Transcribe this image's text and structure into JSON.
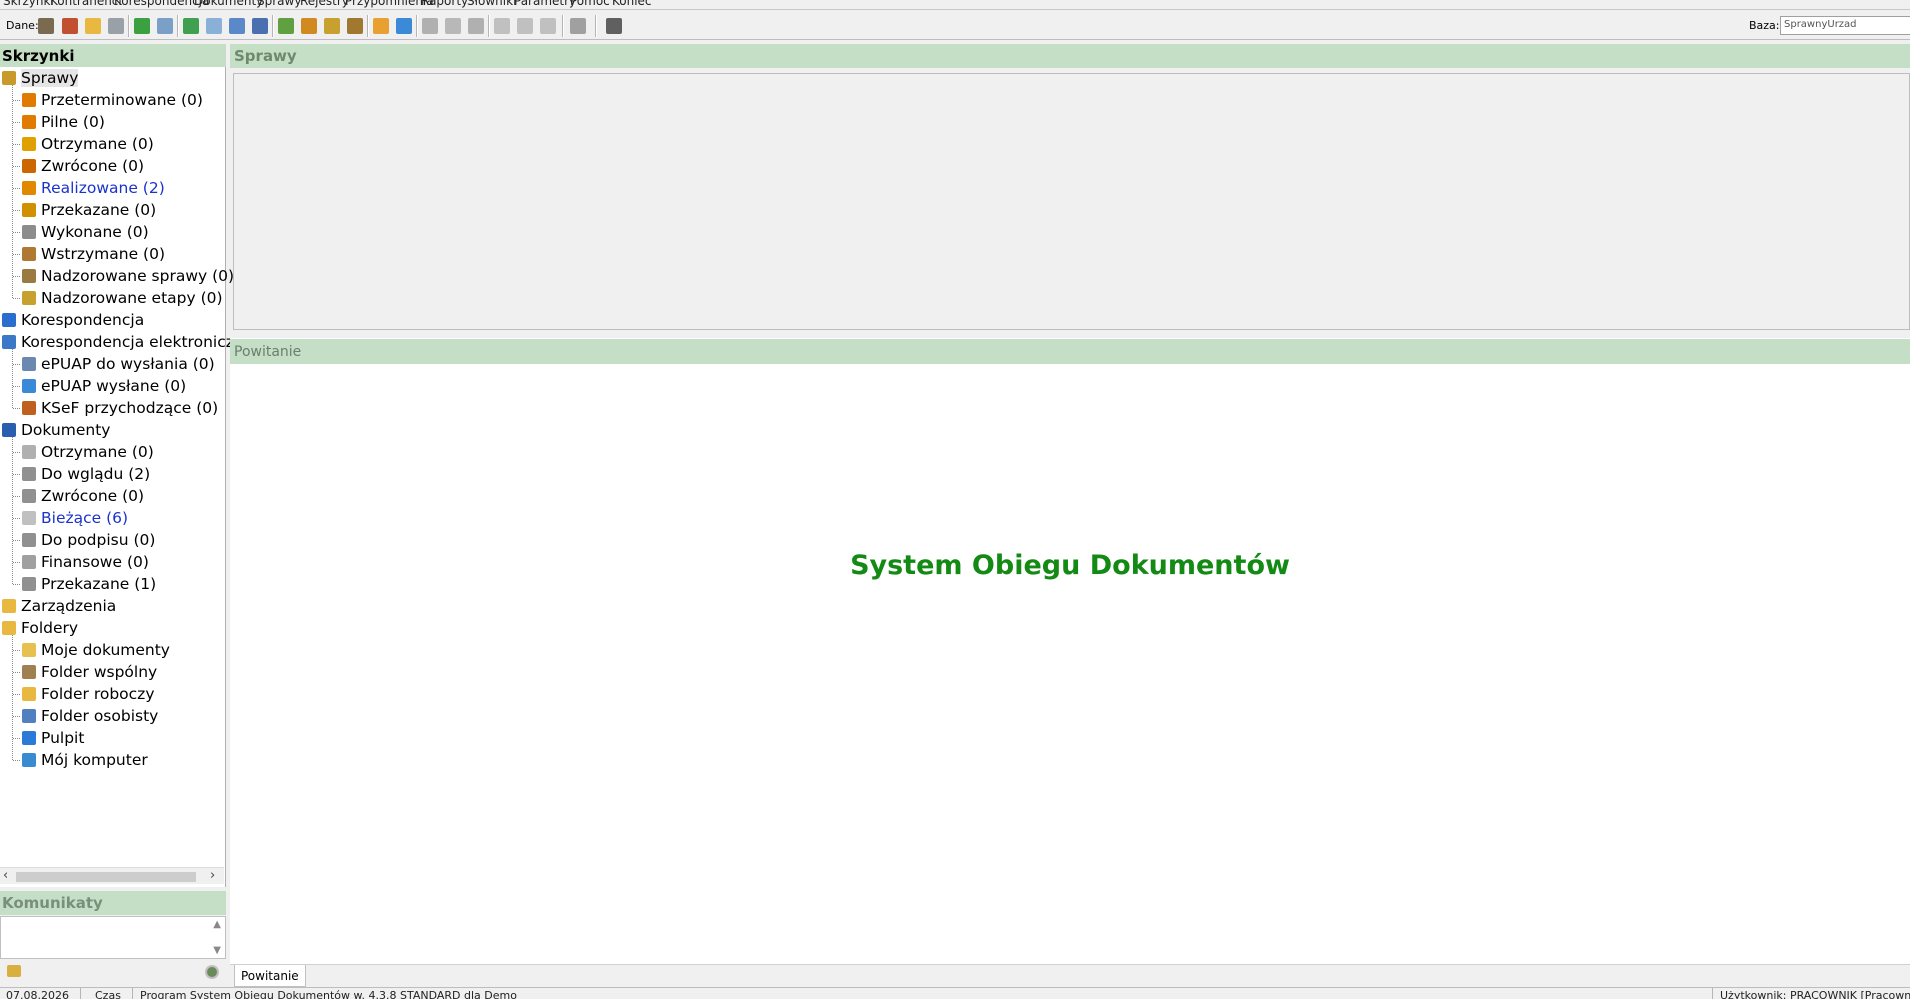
{
  "menu": [
    "Skrzynki",
    "Kontrahenci",
    "Korespondencja",
    "Dokumenty",
    "Sprawy",
    "Rejestry",
    "Przypomnienia",
    "Raporty",
    "Słowniki",
    "Parametry",
    "Pomoc",
    "Koniec"
  ],
  "toolbar": {
    "dane_label": "Dane:",
    "baza_label": "Baza:",
    "baza_value": "SprawnyUrzad"
  },
  "left": {
    "header": "Skrzynki",
    "tree": [
      {
        "label": "Sprawy",
        "level": 0,
        "icon": "case-folder-icon",
        "color": "#c89a2a"
      },
      {
        "label": "Przeterminowane (0)",
        "level": 1,
        "icon": "overdue-icon",
        "color": "#e07a00"
      },
      {
        "label": "Pilne (0)",
        "level": 1,
        "icon": "urgent-icon",
        "color": "#e07a00"
      },
      {
        "label": "Otrzymane (0)",
        "level": 1,
        "icon": "received-icon",
        "color": "#e0a000"
      },
      {
        "label": "Zwrócone (0)",
        "level": 1,
        "icon": "returned-icon",
        "color": "#cc6600"
      },
      {
        "label": "Realizowane (2)",
        "level": 1,
        "icon": "in-progress-icon",
        "color": "#e08800",
        "blue": true
      },
      {
        "label": "Przekazane (0)",
        "level": 1,
        "icon": "forwarded-icon",
        "color": "#d09000"
      },
      {
        "label": "Wykonane (0)",
        "level": 1,
        "icon": "done-icon",
        "color": "#8c8c8c"
      },
      {
        "label": "Wstrzymane (0)",
        "level": 1,
        "icon": "paused-icon",
        "color": "#b07830"
      },
      {
        "label": "Nadzorowane sprawy (0)",
        "level": 1,
        "icon": "supervised-cases-icon",
        "color": "#9a7a40"
      },
      {
        "label": "Nadzorowane etapy (0)",
        "level": 1,
        "icon": "supervised-stages-icon",
        "color": "#c8a030"
      },
      {
        "label": "Korespondencja",
        "level": 0,
        "icon": "correspondence-icon",
        "color": "#2a6fd0"
      },
      {
        "label": "Korespondencja elektroniczn",
        "level": 0,
        "icon": "e-correspondence-icon",
        "color": "#3c78c8"
      },
      {
        "label": "ePUAP do wysłania (0)",
        "level": 1,
        "icon": "epuap-outbox-icon",
        "color": "#6a88b0"
      },
      {
        "label": "ePUAP wysłane (0)",
        "level": 1,
        "icon": "epuap-sent-icon",
        "color": "#3a8ad8"
      },
      {
        "label": "KSeF przychodzące (0)",
        "level": 1,
        "icon": "ksef-icon",
        "color": "#c06020"
      },
      {
        "label": "Dokumenty",
        "level": 0,
        "icon": "documents-icon",
        "color": "#2a5fb0"
      },
      {
        "label": "Otrzymane (0)",
        "level": 1,
        "icon": "doc-received-icon",
        "color": "#b0b0b0"
      },
      {
        "label": "Do wglądu (2)",
        "level": 1,
        "icon": "doc-preview-icon",
        "color": "#909090"
      },
      {
        "label": "Zwrócone (0)",
        "level": 1,
        "icon": "doc-returned-icon",
        "color": "#909090"
      },
      {
        "label": "Bieżące (6)",
        "level": 1,
        "icon": "doc-current-icon",
        "color": "#c0c0c0",
        "blue": true
      },
      {
        "label": "Do podpisu (0)",
        "level": 1,
        "icon": "doc-sign-icon",
        "color": "#909090"
      },
      {
        "label": "Finansowe (0)",
        "level": 1,
        "icon": "doc-finance-icon",
        "color": "#a0a0a0"
      },
      {
        "label": "Przekazane (1)",
        "level": 1,
        "icon": "doc-forwarded-icon",
        "color": "#909090"
      },
      {
        "label": "Zarządzenia",
        "level": 0,
        "icon": "orders-folder-icon",
        "color": "#e8b840"
      },
      {
        "label": "Foldery",
        "level": 0,
        "icon": "folders-icon",
        "color": "#e8b840"
      },
      {
        "label": "Moje dokumenty",
        "level": 1,
        "icon": "my-documents-icon",
        "color": "#e8c050"
      },
      {
        "label": "Folder wspólny",
        "level": 1,
        "icon": "shared-folder-icon",
        "color": "#a08050"
      },
      {
        "label": "Folder roboczy",
        "level": 1,
        "icon": "work-folder-icon",
        "color": "#e8b840"
      },
      {
        "label": "Folder osobisty",
        "level": 1,
        "icon": "personal-folder-icon",
        "color": "#5080c0"
      },
      {
        "label": "Pulpit",
        "level": 1,
        "icon": "desktop-icon",
        "color": "#2a7ad8"
      },
      {
        "label": "Mój komputer",
        "level": 1,
        "icon": "computer-icon",
        "color": "#3a8ad0"
      }
    ],
    "komunikaty_header": "Komunikaty"
  },
  "sprawy_header": "Sprawy",
  "powitanie": {
    "header": "Powitanie",
    "title": "System Obiegu Dokumentów",
    "tab": "Powitanie"
  },
  "status": {
    "date": "07.08.2026",
    "czas": "Czas",
    "program": "Program System Obiegu Dokumentów w. 4.3.8 STANDARD dla Demo",
    "user": "Użytkownik: PRACOWNIK [Pracownik]"
  },
  "colors": {
    "panel_header": "#c5dfc6",
    "accent_green": "#138a13",
    "link_blue": "#1a33cc"
  }
}
